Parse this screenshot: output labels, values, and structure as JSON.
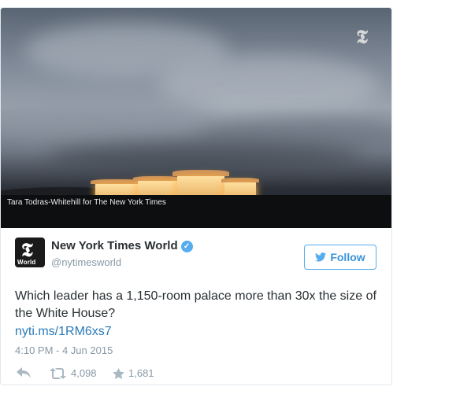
{
  "media": {
    "watermark": "𝕿",
    "credit": "Tara Todras-Whitehill for The New York Times"
  },
  "account": {
    "avatar_letter": "𝕿",
    "avatar_label": "World",
    "name": "New York Times World",
    "handle": "@nytimesworld",
    "verified_mark": "✓"
  },
  "follow_button": {
    "label": "Follow"
  },
  "tweet": {
    "text": "Which leader has a 1,150-room palace more than 30x the size of the White House?",
    "link": "nyti.ms/1RM6xs7",
    "timestamp": "4:10 PM - 4 Jun 2015"
  },
  "actions": {
    "retweets": "4,098",
    "favorites": "1,681"
  }
}
